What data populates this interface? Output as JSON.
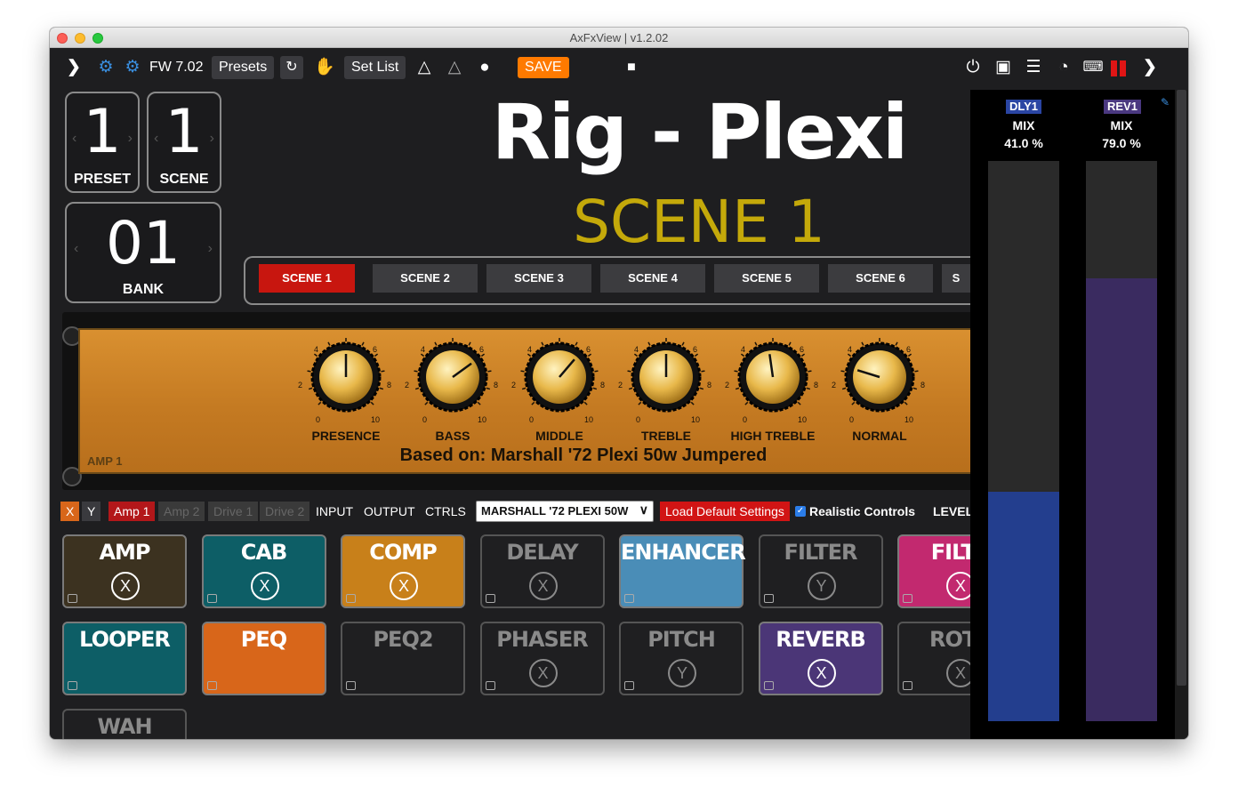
{
  "window": {
    "title": "AxFxView | v1.2.02"
  },
  "toolbar": {
    "fw": "FW 7.02",
    "presets": "Presets",
    "setlist": "Set List",
    "save": "SAVE"
  },
  "preset": {
    "number": "1",
    "label": "PRESET"
  },
  "scene": {
    "number": "1",
    "label": "SCENE"
  },
  "bank": {
    "number": "01",
    "label": "BANK"
  },
  "main": {
    "title": "Rig - Plexi",
    "scene_title": "SCENE 1"
  },
  "scenes": [
    "SCENE 1",
    "SCENE 2",
    "SCENE 3",
    "SCENE 4",
    "SCENE 5",
    "SCENE 6",
    "S"
  ],
  "amp": {
    "label": "AMP 1",
    "based_on": "Based on: Marshall '72 Plexi 50w Jumpered",
    "knobs": [
      {
        "name": "PRESENCE",
        "value": 5.0
      },
      {
        "name": "BASS",
        "value": 7.0
      },
      {
        "name": "MIDDLE",
        "value": 6.5
      },
      {
        "name": "TREBLE",
        "value": 5.0
      },
      {
        "name": "HIGH TREBLE",
        "value": 4.7
      },
      {
        "name": "NORMAL",
        "value": 2.3
      }
    ],
    "scale": {
      "n0": "0",
      "n2": "2",
      "n4": "4",
      "n6": "6",
      "n8": "8",
      "n10": "10"
    }
  },
  "controls": {
    "x": "X",
    "y": "Y",
    "amp1": "Amp 1",
    "amp2": "Amp 2",
    "drive1": "Drive 1",
    "drive2": "Drive 2",
    "input": "INPUT",
    "output": "OUTPUT",
    "ctrls": "CTRLS",
    "model": "MARSHALL '72 PLEXI 50W",
    "load_default": "Load Default Settings",
    "realistic": "Realistic Controls",
    "level": "LEVEL"
  },
  "blocks": [
    {
      "name": "AMP",
      "badge": "X",
      "bg": "#3c3220",
      "fg": "#ffffff",
      "active": true
    },
    {
      "name": "CAB",
      "badge": "X",
      "bg": "#0d5e66",
      "fg": "#ffffff",
      "active": true
    },
    {
      "name": "COMP",
      "badge": "X",
      "bg": "#c8801a",
      "fg": "#ffffff",
      "active": true
    },
    {
      "name": "DELAY",
      "badge": "X",
      "bg": "#1f1f21",
      "fg": "#8a8a8a",
      "active": false
    },
    {
      "name": "ENHANCER",
      "badge": "",
      "bg": "#4a8db7",
      "fg": "#ffffff",
      "active": true
    },
    {
      "name": "FILTER",
      "badge": "Y",
      "bg": "#1f1f21",
      "fg": "#8a8a8a",
      "active": false
    },
    {
      "name": "FILTE",
      "badge": "X",
      "bg": "#c2296f",
      "fg": "#ffffff",
      "active": true
    },
    {
      "name": "LOOPER",
      "badge": "",
      "bg": "#0d5e66",
      "fg": "#ffffff",
      "active": true
    },
    {
      "name": "PEQ",
      "badge": "",
      "bg": "#d8661a",
      "fg": "#ffffff",
      "active": true
    },
    {
      "name": "PEQ2",
      "badge": "",
      "bg": "#1f1f21",
      "fg": "#8a8a8a",
      "active": false
    },
    {
      "name": "PHASER",
      "badge": "X",
      "bg": "#1f1f21",
      "fg": "#8a8a8a",
      "active": false
    },
    {
      "name": "PITCH",
      "badge": "Y",
      "bg": "#1f1f21",
      "fg": "#8a8a8a",
      "active": false
    },
    {
      "name": "REVERB",
      "badge": "X",
      "bg": "#4b3677",
      "fg": "#ffffff",
      "active": true
    },
    {
      "name": "ROTA",
      "badge": "X",
      "bg": "#1f1f21",
      "fg": "#8a8a8a",
      "active": false
    },
    {
      "name": "WAH",
      "badge": "",
      "bg": "#1f1f21",
      "fg": "#8a8a8a",
      "active": false
    }
  ],
  "meters": [
    {
      "tag": "DLY1",
      "param": "MIX",
      "value": "41.0 %",
      "level": 0.41,
      "color": "#233e8e",
      "tag_bg": "#2a45a3"
    },
    {
      "tag": "REV1",
      "param": "MIX",
      "value": "79.0 %",
      "level": 0.79,
      "color": "#3a2b60",
      "tag_bg": "#4a3880"
    }
  ],
  "colors": {
    "scene_active": "#c8160f",
    "scene_title": "#c4a90a",
    "accent_save": "#ff7a00"
  }
}
